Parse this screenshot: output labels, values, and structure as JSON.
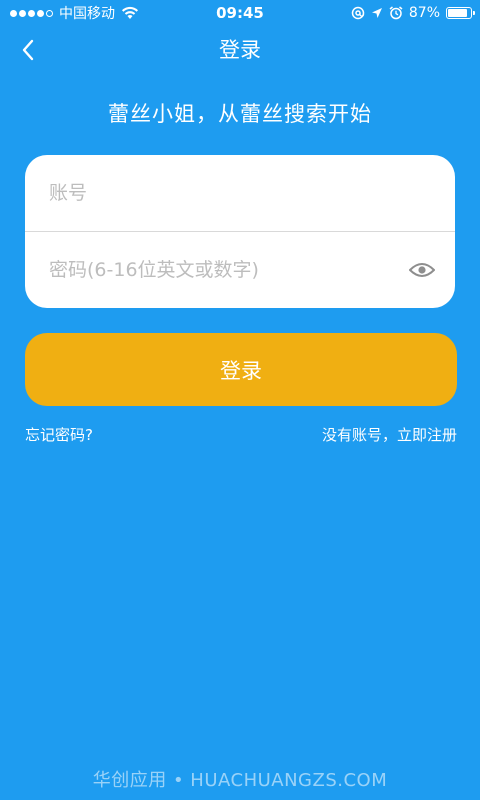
{
  "status_bar": {
    "carrier": "中国移动",
    "time": "09:45",
    "battery_percent": "87%",
    "battery_level": 0.87,
    "icons": [
      "signal-dots",
      "wifi-icon",
      "at-lock-icon",
      "location-arrow-icon",
      "alarm-icon",
      "battery-icon"
    ]
  },
  "nav": {
    "back_icon": "chevron-left-icon",
    "title": "登录"
  },
  "slogan": "蕾丝小姐，从蕾丝搜索开始",
  "form": {
    "account_placeholder": "账号",
    "account_value": "",
    "password_placeholder": "密码(6-16位英文或数字)",
    "password_value": "",
    "eye_icon": "eye-icon"
  },
  "login_button": "登录",
  "links": {
    "forgot_password": "忘记密码?",
    "register": "没有账号，立即注册"
  },
  "watermark": "华创应用 • HUACHUANGZS.COM",
  "colors": {
    "background": "#1E9CF0",
    "button": "#F0AF12",
    "card": "#FFFFFF",
    "placeholder": "#BDBDBD"
  }
}
